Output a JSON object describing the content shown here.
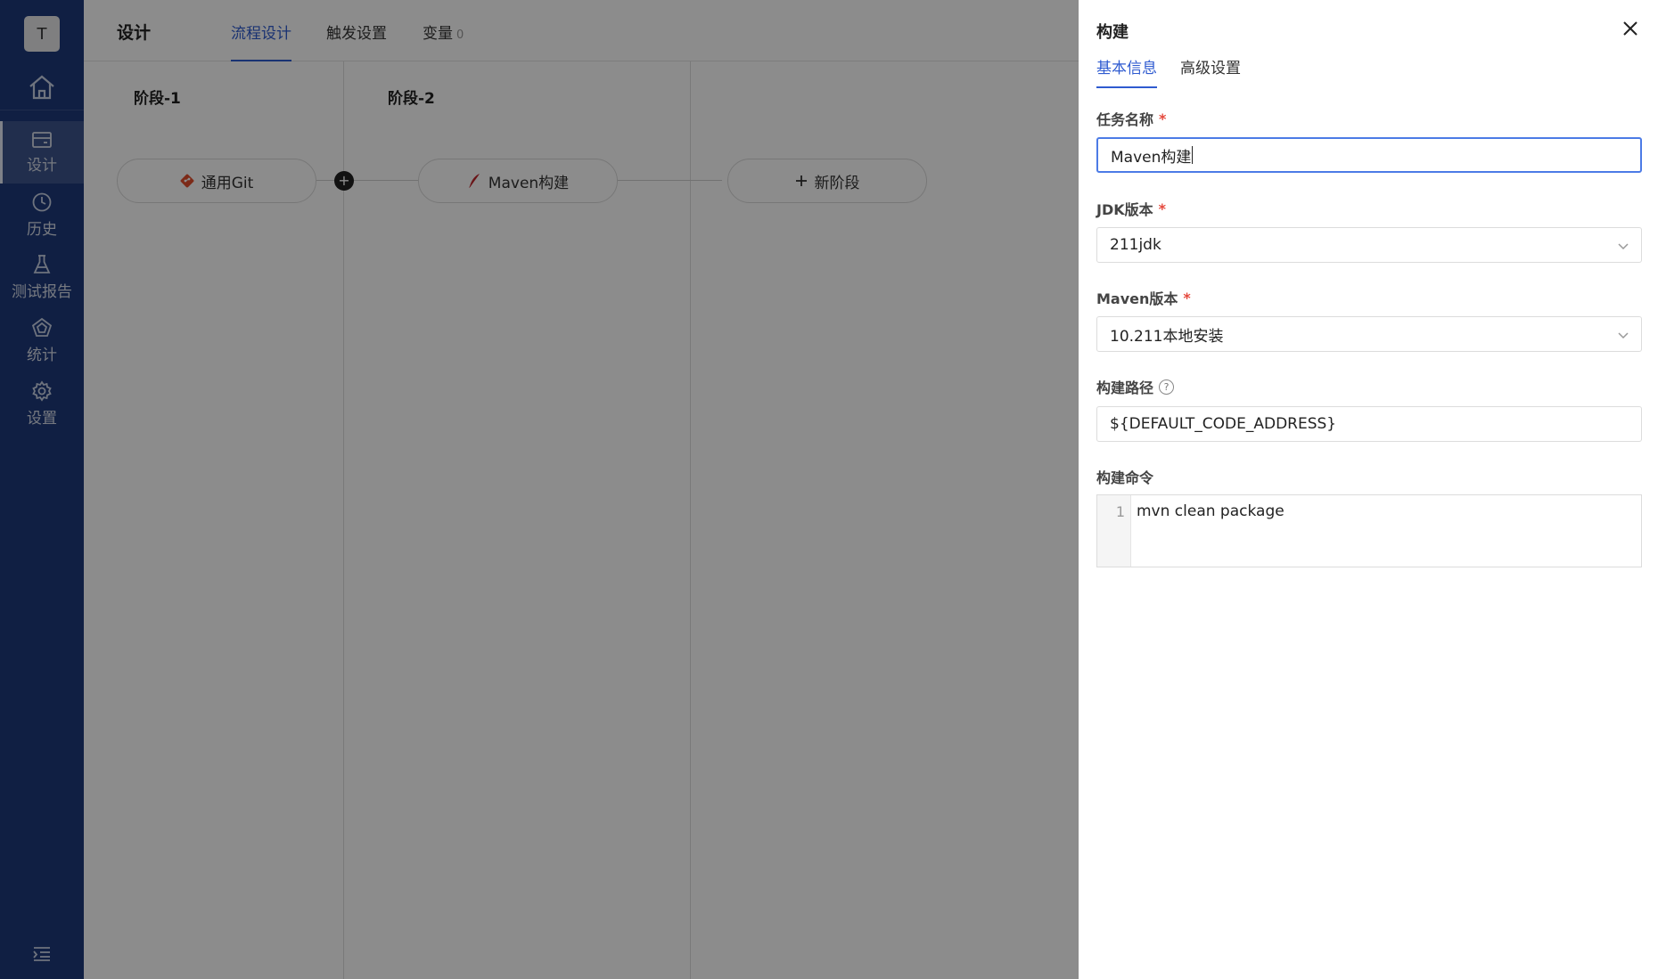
{
  "sidebar": {
    "avatar": "T",
    "items": [
      {
        "label": "设计",
        "icon": "pipeline-design-icon"
      },
      {
        "label": "历史",
        "icon": "clock-icon"
      },
      {
        "label": "测试报告",
        "icon": "flask-icon"
      },
      {
        "label": "统计",
        "icon": "pentagon-chart-icon"
      },
      {
        "label": "设置",
        "icon": "gear-icon"
      }
    ]
  },
  "header": {
    "title": "设计",
    "tabs": [
      {
        "label": "流程设计"
      },
      {
        "label": "触发设置"
      },
      {
        "label": "变量",
        "count": "0"
      }
    ]
  },
  "stages": [
    {
      "title": "阶段-1",
      "task": "通用Git",
      "task_icon": "git-icon"
    },
    {
      "title": "阶段-2",
      "task": "Maven构建",
      "task_icon": "maven-feather-icon"
    }
  ],
  "new_stage": {
    "label": "新阶段"
  },
  "drawer": {
    "title": "构建",
    "tabs": [
      {
        "label": "基本信息"
      },
      {
        "label": "高级设置"
      }
    ],
    "fields": {
      "task_name": {
        "label": "任务名称",
        "value": "Maven构建"
      },
      "jdk": {
        "label": "JDK版本",
        "value": "211jdk"
      },
      "maven": {
        "label": "Maven版本",
        "value": "10.211本地安装"
      },
      "build_path": {
        "label": "构建路径",
        "value": "${DEFAULT_CODE_ADDRESS}"
      },
      "build_cmd": {
        "label": "构建命令",
        "line_number": "1",
        "value": "mvn clean package"
      }
    },
    "required_mark": "*",
    "help_mark": "?"
  },
  "colors": {
    "sidebar_bg": "#1e3a7a",
    "accent": "#2f5bd0",
    "required": "#e5483c",
    "overlay": "rgba(0,0,0,0.45)"
  }
}
